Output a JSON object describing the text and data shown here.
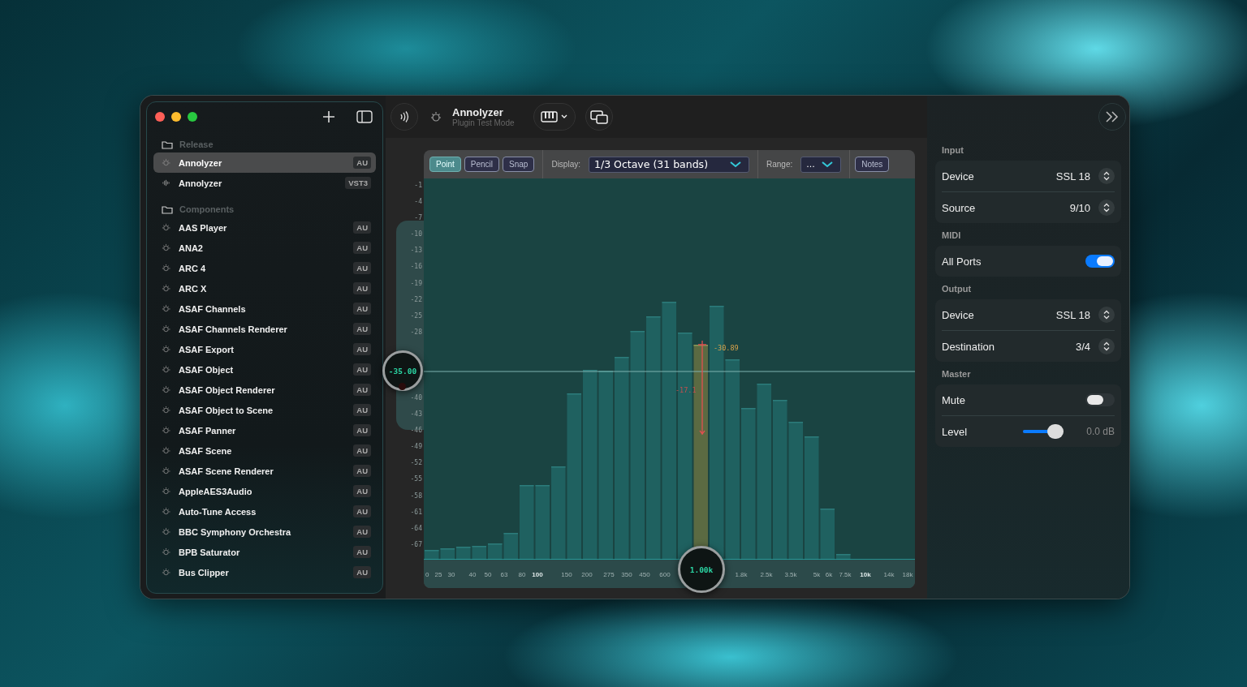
{
  "sidebar": {
    "sections": [
      {
        "title": "Release",
        "items": [
          {
            "name": "Annolyzer",
            "badge": "AU",
            "kind": "au",
            "selected": true
          },
          {
            "name": "Annolyzer",
            "badge": "VST3",
            "kind": "vst3",
            "selected": false
          }
        ]
      },
      {
        "title": "Components",
        "items": [
          {
            "name": "AAS Player",
            "badge": "AU",
            "kind": "au",
            "selected": false
          },
          {
            "name": "ANA2",
            "badge": "AU",
            "kind": "au",
            "selected": false
          },
          {
            "name": "ARC 4",
            "badge": "AU",
            "kind": "au",
            "selected": false
          },
          {
            "name": "ARC X",
            "badge": "AU",
            "kind": "au",
            "selected": false
          },
          {
            "name": "ASAF Channels",
            "badge": "AU",
            "kind": "au",
            "selected": false
          },
          {
            "name": "ASAF Channels Renderer",
            "badge": "AU",
            "kind": "au",
            "selected": false
          },
          {
            "name": "ASAF Export",
            "badge": "AU",
            "kind": "au",
            "selected": false
          },
          {
            "name": "ASAF Object",
            "badge": "AU",
            "kind": "au",
            "selected": false
          },
          {
            "name": "ASAF Object Renderer",
            "badge": "AU",
            "kind": "au",
            "selected": false
          },
          {
            "name": "ASAF Object to Scene",
            "badge": "AU",
            "kind": "au",
            "selected": false
          },
          {
            "name": "ASAF Panner",
            "badge": "AU",
            "kind": "au",
            "selected": false
          },
          {
            "name": "ASAF Scene",
            "badge": "AU",
            "kind": "au",
            "selected": false
          },
          {
            "name": "ASAF Scene Renderer",
            "badge": "AU",
            "kind": "au",
            "selected": false
          },
          {
            "name": "AppleAES3Audio",
            "badge": "AU",
            "kind": "au",
            "selected": false
          },
          {
            "name": "Auto-Tune Access",
            "badge": "AU",
            "kind": "au",
            "selected": false
          },
          {
            "name": "BBC Symphony Orchestra",
            "badge": "AU",
            "kind": "au",
            "selected": false
          },
          {
            "name": "BPB Saturator",
            "badge": "AU",
            "kind": "au",
            "selected": false
          },
          {
            "name": "Bus Clipper",
            "badge": "AU",
            "kind": "au",
            "selected": false
          }
        ]
      }
    ]
  },
  "toolbar": {
    "title": "Annolyzer",
    "subtitle": "Plugin Test Mode"
  },
  "analyzer": {
    "tools": [
      {
        "label": "Point",
        "selected": true
      },
      {
        "label": "Pencil",
        "selected": false
      },
      {
        "label": "Snap",
        "selected": false
      }
    ],
    "display_label": "Display:",
    "display_value": "1/3 Octave (31 bands)",
    "range_label": "Range:",
    "range_value": "...",
    "notes_button": "Notes",
    "y_ticks_upper": [
      "-1",
      "-4",
      "-7",
      "-10",
      "-13",
      "-16",
      "-19",
      "-22",
      "-25",
      "-28"
    ],
    "y_ticks_lower": [
      "-40",
      "-43",
      "-46",
      "-49",
      "-52",
      "-55",
      "-58",
      "-61",
      "-64",
      "-67"
    ],
    "x_ticks": [
      {
        "label": "0",
        "major": false
      },
      {
        "label": "25",
        "major": false
      },
      {
        "label": "30",
        "major": false
      },
      {
        "label": "40",
        "major": false
      },
      {
        "label": "50",
        "major": false
      },
      {
        "label": "63",
        "major": false
      },
      {
        "label": "80",
        "major": false
      },
      {
        "label": "100",
        "major": true
      },
      {
        "label": "150",
        "major": false
      },
      {
        "label": "200",
        "major": false
      },
      {
        "label": "275",
        "major": false
      },
      {
        "label": "350",
        "major": false
      },
      {
        "label": "450",
        "major": false
      },
      {
        "label": "600",
        "major": false
      },
      {
        "label": "1.8k",
        "major": false
      },
      {
        "label": "2.5k",
        "major": false
      },
      {
        "label": "3.5k",
        "major": false
      },
      {
        "label": "5k",
        "major": false
      },
      {
        "label": "6k",
        "major": false
      },
      {
        "label": "7.5k",
        "major": false
      },
      {
        "label": "10k",
        "major": true
      },
      {
        "label": "14k",
        "major": false
      },
      {
        "label": "18k",
        "major": false
      }
    ],
    "gain_knob": "-35.00",
    "frequency_knob": "1.00k",
    "band_readout": "-30.89",
    "band_delta": "-17.1"
  },
  "inspector": {
    "sections": [
      {
        "title": "Input",
        "rows": [
          {
            "kind": "stepper",
            "label": "Device",
            "value": "SSL 18"
          },
          {
            "kind": "stepper",
            "label": "Source",
            "value": "9/10"
          }
        ]
      },
      {
        "title": "MIDI",
        "rows": [
          {
            "kind": "toggle",
            "label": "All Ports",
            "on": true
          }
        ]
      },
      {
        "title": "Output",
        "rows": [
          {
            "kind": "stepper",
            "label": "Device",
            "value": "SSL 18"
          },
          {
            "kind": "stepper",
            "label": "Destination",
            "value": "3/4"
          }
        ]
      },
      {
        "title": "Master",
        "rows": [
          {
            "kind": "toggle",
            "label": "Mute",
            "on": false
          },
          {
            "kind": "slider",
            "label": "Level",
            "level": 0.8,
            "reading": "0.0 dB"
          }
        ]
      }
    ]
  }
}
